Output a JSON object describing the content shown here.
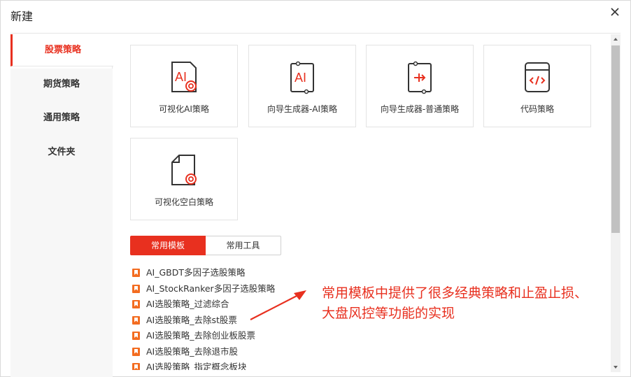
{
  "window": {
    "title": "新建"
  },
  "sidebar": {
    "items": [
      {
        "label": "股票策略",
        "active": true
      },
      {
        "label": "期货策略",
        "active": false
      },
      {
        "label": "通用策略",
        "active": false
      },
      {
        "label": "文件夹",
        "active": false
      }
    ]
  },
  "cards": [
    {
      "label": "可视化AI策略",
      "icon": "visual-ai-icon"
    },
    {
      "label": "向导生成器-AI策略",
      "icon": "wizard-ai-icon"
    },
    {
      "label": "向导生成器-普通策略",
      "icon": "wizard-normal-icon"
    },
    {
      "label": "代码策略",
      "icon": "code-icon"
    },
    {
      "label": "可视化空白策略",
      "icon": "visual-blank-icon"
    }
  ],
  "tabs": [
    {
      "label": "常用模板",
      "active": true
    },
    {
      "label": "常用工具",
      "active": false
    }
  ],
  "templates": [
    "AI_GBDT多因子选股策略",
    "AI_StockRanker多因子选股策略",
    "AI选股策略_过滤综合",
    "AI选股策略_去除st股票",
    "AI选股策略_去除创业板股票",
    "AI选股策略_去除退市股",
    "AI选股策略_指定概念板块"
  ],
  "annotation": {
    "line1": "常用模板中提供了很多经典策略和止盈止损、",
    "line2": "大盘风控等功能的实现"
  },
  "colors": {
    "accent": "#e8301f",
    "bookmark": "#f36c20"
  }
}
